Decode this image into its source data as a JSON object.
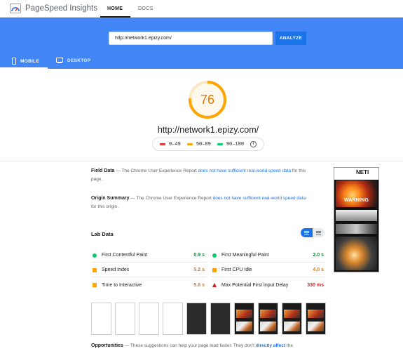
{
  "app": {
    "title": "PageSpeed Insights"
  },
  "nav": {
    "home": "HOME",
    "docs": "DOCS"
  },
  "search": {
    "url": "http://network1.epizy.com/",
    "analyze": "ANALYZE"
  },
  "device_tabs": {
    "mobile": "MOBILE",
    "desktop": "DESKTOP"
  },
  "score": {
    "value": "76",
    "fraction": 0.76,
    "color": "#e67700"
  },
  "page_url": "http://network1.epizy.com/",
  "legend": [
    {
      "label": "0–49",
      "color": "#e53935"
    },
    {
      "label": "50–89",
      "color": "#ffa400"
    },
    {
      "label": "90–100",
      "color": "#0cce6b"
    }
  ],
  "field_data": {
    "title": "Field Data",
    "pre": "— The Chrome User Experience Report",
    "link": "does not have sufficient real-world speed data",
    "post": "for this page."
  },
  "origin_summary": {
    "title": "Origin Summary",
    "pre": "— The Chrome User Experience Report",
    "link": "does not have sufficient real-world speed data",
    "post": "for this origin."
  },
  "lab_data": {
    "title": "Lab Data"
  },
  "metrics": [
    {
      "name": "First Contentful Paint",
      "value": "0.9 s",
      "status": "good"
    },
    {
      "name": "First Meaningful Paint",
      "value": "2.0 s",
      "status": "good"
    },
    {
      "name": "Speed Index",
      "value": "5.2 s",
      "status": "average"
    },
    {
      "name": "First CPU Idle",
      "value": "4.0 s",
      "status": "average"
    },
    {
      "name": "Time to Interactive",
      "value": "5.8 s",
      "status": "average"
    },
    {
      "name": "Max Potential First Input Delay",
      "value": "330 ms",
      "status": "poor"
    }
  ],
  "status_colors": {
    "good": "#0a8f3c",
    "average": "#e67700",
    "poor": "#c7221f"
  },
  "thumbnail": {
    "logo_text": "NETI",
    "warning_text": "WARNING"
  },
  "opportunities": {
    "title": "Opportunities",
    "pre": "— These suggestions can help your page load faster. They don't",
    "link": "directly affect",
    "post": "the"
  }
}
